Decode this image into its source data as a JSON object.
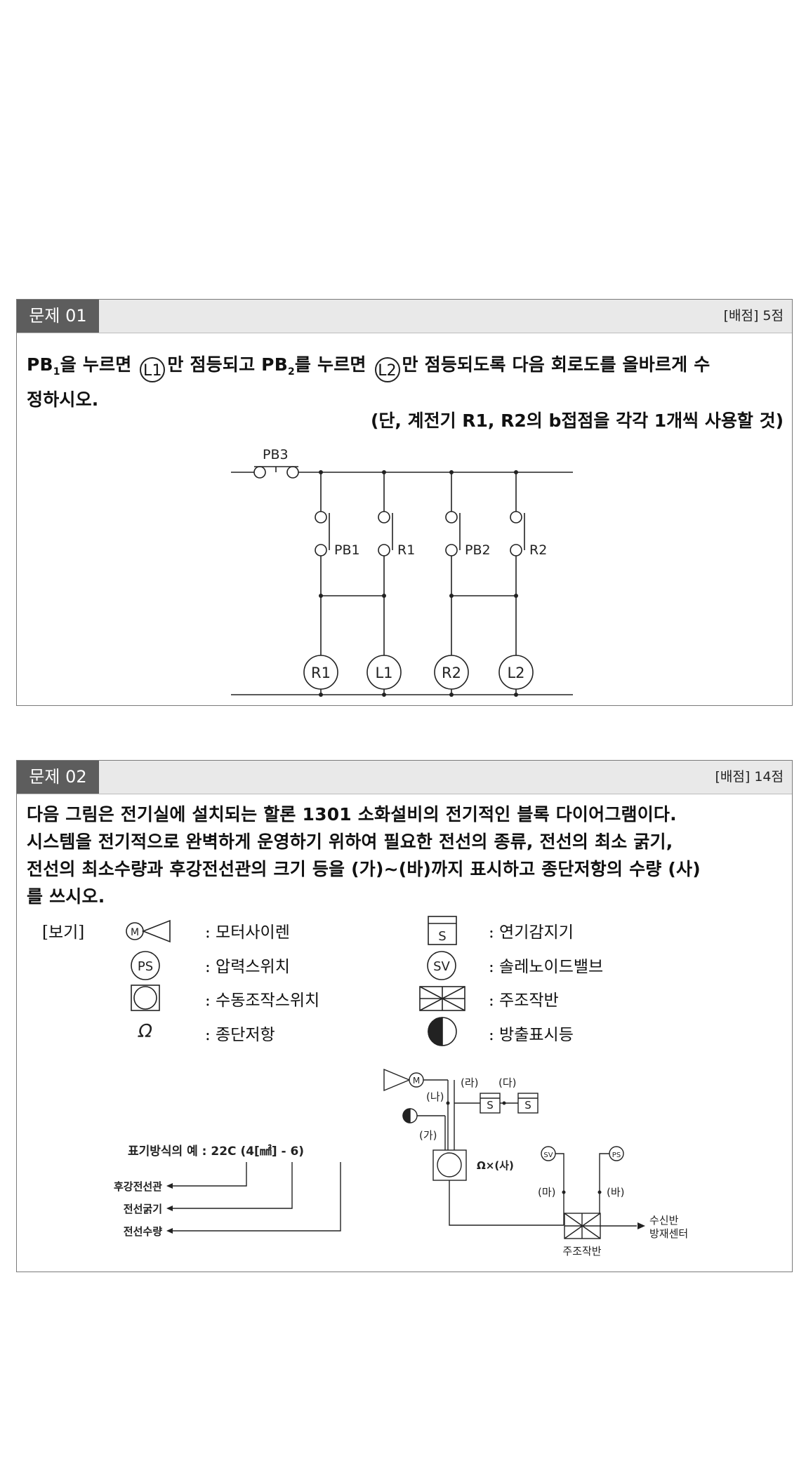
{
  "problem1": {
    "tag": "문제 01",
    "score": "[배점] 5점",
    "line1_a": "PB",
    "line1_b": "을 누르면",
    "lamp1": "L1",
    "line1_c": "만 점등되고 PB",
    "line1_d": "를 누르면",
    "lamp2": "L2",
    "line1_e": "만 점등되도록 다음 회로도를 올바르게 수",
    "line2": "정하시오.",
    "condition": "(단, 계전기 R1, R2의 b접점을 각각 1개씩 사용할 것)",
    "circuit": {
      "pb3": "PB3",
      "pb1": "PB1",
      "r1": "R1",
      "pb2": "PB2",
      "r2": "R2",
      "coil_r1": "R1",
      "coil_l1": "L1",
      "coil_r2": "R2",
      "coil_l2": "L2"
    }
  },
  "problem2": {
    "tag": "문제 02",
    "score": "[배점] 14점",
    "text_lines": [
      "다음 그림은 전기실에 설치되는 할론 1301 소화설비의 전기적인 블록 다이어그램이다.",
      "시스템을 전기적으로 완벽하게 운영하기 위하여 필요한 전선의 종류, 전선의 최소 굵기,",
      "전선의 최소수량과 후강전선관의 크기 등을 (가)~(바)까지 표시하고 종단저항의 수량 (사)",
      "를 쓰시오."
    ],
    "legend_title": "[보기]",
    "legend": {
      "motor_siren": ": 모터사이렌",
      "pressure_switch": ": 압력스위치",
      "manual_switch": ": 수동조작스위치",
      "end_resistor": ": 종단저항",
      "smoke_detector": ": 연기감지기",
      "solenoid_valve": ": 솔레노이드밸브",
      "main_panel": ": 주조작반",
      "discharge_lamp": ": 방출표시등"
    },
    "symbols": {
      "m": "M",
      "ps": "PS",
      "s": "S",
      "sv": "SV",
      "omega": "Ω"
    },
    "notation": {
      "example": "표기방식의 예 : 22C (4[㎟] - 6)",
      "conduit": "후강전선관",
      "thickness": "전선굵기",
      "quantity": "전선수량"
    },
    "diagram": {
      "ga": "(가)",
      "na": "(나)",
      "da": "(다)",
      "ra": "(라)",
      "ma": "(마)",
      "ba": "(바)",
      "sa": "Ω×(사)",
      "m": "M",
      "s": "S",
      "sv": "SV",
      "ps": "PS",
      "panel_label": "주조작반",
      "receiver": "수신반",
      "center": "방재센터"
    }
  }
}
